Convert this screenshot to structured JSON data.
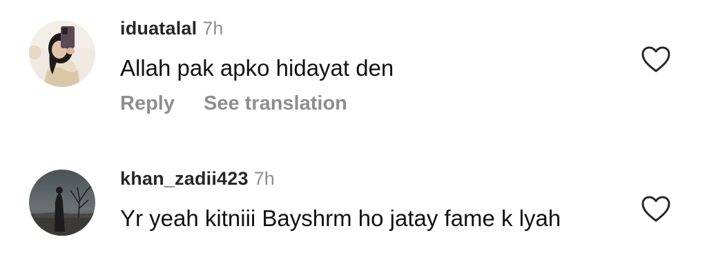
{
  "comments": [
    {
      "username": "iduatalal",
      "time": "7h",
      "text": "Allah pak apko hidayat den",
      "reply_label": "Reply",
      "translate_label": "See translation",
      "avatar_icon": "user-avatar-selfie",
      "like_icon": "heart-outline-icon"
    },
    {
      "username": "khan_zadii423",
      "time": "7h",
      "text": "Yr yeah kitniii Bayshrm ho jatay fame k lyah",
      "avatar_icon": "user-avatar-landscape",
      "like_icon": "heart-outline-icon"
    }
  ],
  "colors": {
    "username": "#262626",
    "secondary": "#8e8e8e",
    "text": "#111111",
    "icon": "#262626"
  }
}
